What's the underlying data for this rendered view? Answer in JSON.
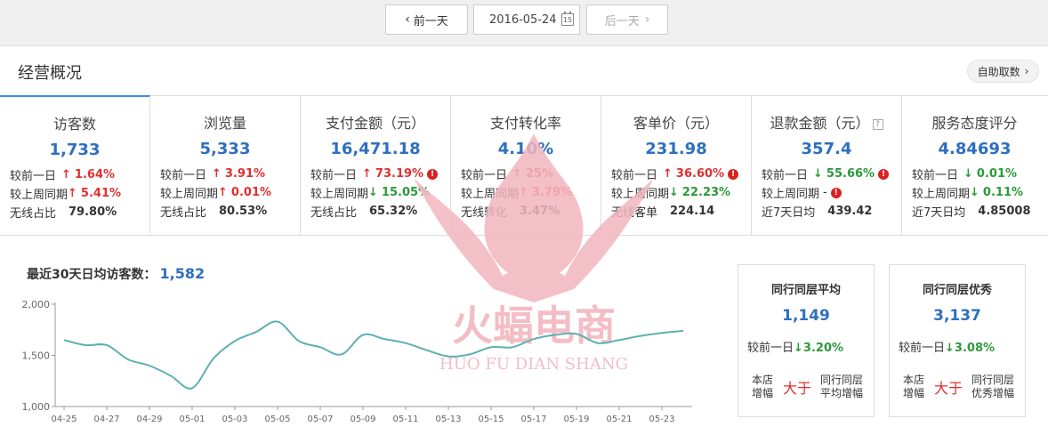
{
  "date_nav": {
    "prev_label": "前一天",
    "date": "2016-05-24",
    "calendar_day": "15",
    "next_label": "后一天"
  },
  "section": {
    "title": "经营概况",
    "help_label": "自助取数"
  },
  "metrics": [
    {
      "label": "访客数",
      "value": "1,733",
      "r1_label": "较前一日",
      "r1_dir": "up",
      "r1_val": "1.64%",
      "r1_warn": false,
      "r2_label": "较上周同期",
      "r2_dir": "up",
      "r2_val": "5.41%",
      "r2_warn": false,
      "r3_label": "无线占比",
      "r3_val": "79.80%"
    },
    {
      "label": "浏览量",
      "value": "5,333",
      "r1_label": "较前一日",
      "r1_dir": "up",
      "r1_val": "3.91%",
      "r1_warn": false,
      "r2_label": "较上周同期",
      "r2_dir": "up",
      "r2_val": "0.01%",
      "r2_warn": false,
      "r3_label": "无线占比",
      "r3_val": "80.53%"
    },
    {
      "label": "支付金额（元）",
      "value": "16,471.18",
      "r1_label": "较前一日",
      "r1_dir": "up",
      "r1_val": "73.19%",
      "r1_warn": true,
      "r2_label": "较上周同期",
      "r2_dir": "down",
      "r2_val": "15.05%",
      "r2_warn": false,
      "r3_label": "无线占比",
      "r3_val": "65.32%"
    },
    {
      "label": "支付转化率",
      "value": "4.10%",
      "r1_label": "较前一日",
      "r1_dir": "up",
      "r1_val": "25%",
      "r1_warn": false,
      "r2_label": "较上周同期",
      "r2_dir": "up",
      "r2_val": "3.79%",
      "r2_warn": false,
      "r3_label": "无线转化",
      "r3_val": "3.47%"
    },
    {
      "label": "客单价（元）",
      "value": "231.98",
      "r1_label": "较前一日",
      "r1_dir": "up",
      "r1_val": "36.60%",
      "r1_warn": true,
      "r2_label": "较上周同期",
      "r2_dir": "down",
      "r2_val": "22.23%",
      "r2_warn": false,
      "r3_label": "无线客单",
      "r3_val": "224.14"
    },
    {
      "label": "退款金额（元）",
      "value": "357.4",
      "help": true,
      "r1_label": "较前一日",
      "r1_dir": "down",
      "r1_val": "55.66%",
      "r1_warn": true,
      "r2_label": "较上周同期",
      "r2_dir": "",
      "r2_val": "-",
      "r2_warn": true,
      "r3_label": "近7天日均",
      "r3_val": "439.42"
    },
    {
      "label": "服务态度评分",
      "value": "4.84693",
      "r1_label": "较前一日",
      "r1_dir": "down",
      "r1_val": "0.01%",
      "r1_warn": false,
      "r2_label": "较上周同期",
      "r2_dir": "down",
      "r2_val": "0.11%",
      "r2_warn": false,
      "r3_label": "近7天日均",
      "r3_val": "4.85008"
    }
  ],
  "chart_header": {
    "label": "最近30天日均访客数：",
    "value": "1,582"
  },
  "colors": {
    "accent": "#2e6fbf",
    "line": "#5fb0b0",
    "up": "#e03030",
    "down": "#2a9a3a",
    "watermark": "#f3b6bf"
  },
  "watermark": {
    "title": "火蝠电商",
    "subtitle": "HUO FU DIAN SHANG"
  },
  "peer_cards": [
    {
      "title": "同行同层平均",
      "value": "1,149",
      "cmp_label": "较前一日",
      "cmp_dir": "down",
      "cmp_val": "3.20%",
      "foot_a": "本店增幅",
      "foot_big": "大于",
      "foot_b": "同行同层平均增幅"
    },
    {
      "title": "同行同层优秀",
      "value": "3,137",
      "cmp_label": "较前一日",
      "cmp_dir": "down",
      "cmp_val": "3.08%",
      "foot_a": "本店增幅",
      "foot_big": "大于",
      "foot_b": "同行同层优秀增幅"
    }
  ],
  "chart_data": {
    "type": "line",
    "title": "",
    "xlabel": "",
    "ylabel": "",
    "ylim": [
      1000,
      2000
    ],
    "yticks": [
      "2,000",
      "1,500",
      "1,000"
    ],
    "yvals": [
      2000,
      1500,
      1000
    ],
    "xticks": [
      "04-25",
      "04-27",
      "04-29",
      "05-01",
      "05-03",
      "05-05",
      "05-07",
      "05-09",
      "05-11",
      "05-13",
      "05-15",
      "05-17",
      "05-19",
      "05-21",
      "05-23"
    ],
    "grid": false,
    "series": [
      {
        "x": [
          "04-25",
          "04-26",
          "04-27",
          "04-28",
          "04-29",
          "04-30",
          "05-01",
          "05-02",
          "05-03",
          "05-04",
          "05-05",
          "05-06",
          "05-07",
          "05-08",
          "05-09",
          "05-10",
          "05-11",
          "05-12",
          "05-13",
          "05-14",
          "05-15",
          "05-16",
          "05-17",
          "05-18",
          "05-19",
          "05-20",
          "05-21",
          "05-22",
          "05-23",
          "05-24"
        ],
        "values": [
          1650,
          1600,
          1600,
          1460,
          1400,
          1300,
          1180,
          1470,
          1640,
          1730,
          1830,
          1640,
          1580,
          1510,
          1700,
          1660,
          1620,
          1550,
          1490,
          1510,
          1580,
          1580,
          1660,
          1700,
          1710,
          1620,
          1650,
          1690,
          1720,
          1740
        ]
      }
    ]
  }
}
